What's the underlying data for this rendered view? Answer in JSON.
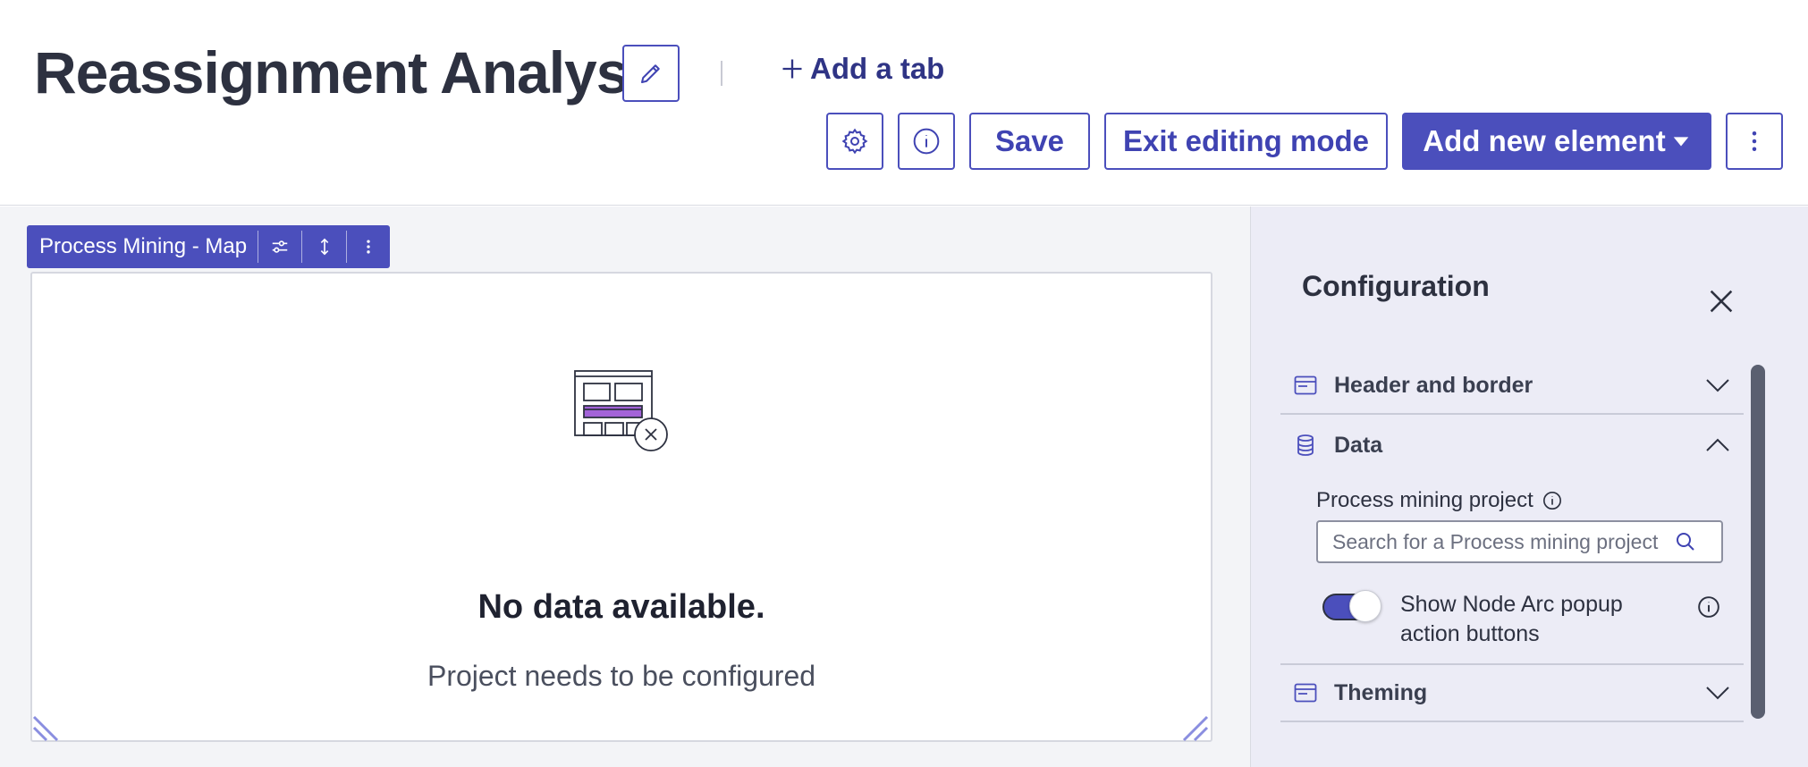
{
  "page": {
    "title": "Reassignment Analysis",
    "add_tab_label": "Add a tab"
  },
  "toolbar": {
    "save_label": "Save",
    "exit_label": "Exit editing mode",
    "add_element_label": "Add new element"
  },
  "widget": {
    "title": "Process Mining - Map",
    "empty_title": "No data available.",
    "empty_subtitle": "Project needs to be configured"
  },
  "config": {
    "title": "Configuration",
    "sections": {
      "header_border": "Header and border",
      "data": "Data",
      "theming": "Theming"
    },
    "data": {
      "project_label": "Process mining project",
      "search_placeholder": "Search for a Process mining project",
      "toggle_label": "Show Node Arc popup action buttons",
      "toggle_on": true
    }
  },
  "colors": {
    "accent": "#4b4fbc",
    "panel_bg": "#ececf6",
    "canvas_bg": "#f3f4f7",
    "illustration_purple": "#a363d9"
  },
  "icons": [
    "pencil-icon",
    "plus-icon",
    "gear-icon",
    "info-icon",
    "caret-down-icon",
    "kebab-icon",
    "sliders-icon",
    "vertical-arrows-icon",
    "close-icon",
    "browser-icon",
    "database-icon",
    "chevron-down-icon",
    "chevron-up-icon",
    "search-icon"
  ]
}
